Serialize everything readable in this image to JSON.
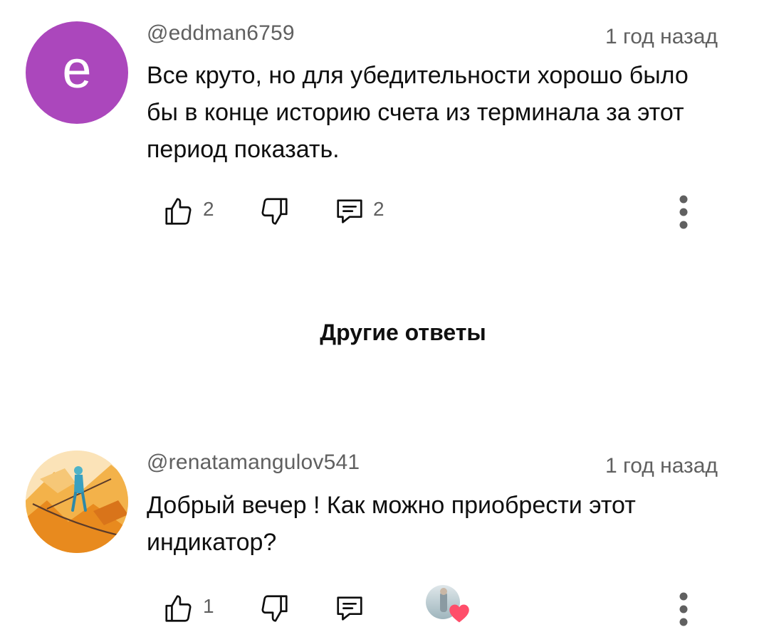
{
  "comments": [
    {
      "avatar_letter": "e",
      "avatar_color": "#ab47bc",
      "author": "@eddman6759",
      "time": "1 год назад",
      "text": "Все круто, но для убедительности хорошо было бы в конце историю счета из терминала за этот период показать.",
      "likes": "2",
      "replies": "2",
      "icons": [
        "thumb-up-icon",
        "thumb-down-icon",
        "reply-icon",
        "more-vert-icon"
      ]
    },
    {
      "author": "@renatamangulov541",
      "time": "1 год назад",
      "text": "Добрый вечер ! Как можно приобрести этот индикатор?",
      "likes": "1",
      "icons": [
        "thumb-up-icon",
        "thumb-down-icon",
        "reply-icon",
        "creator-heart-icon",
        "more-vert-icon"
      ]
    }
  ],
  "other_replies_label": "Другие ответы",
  "colors": {
    "text_primary": "#0f0f0f",
    "text_secondary": "#606060",
    "heart": "#ff4e6a"
  }
}
